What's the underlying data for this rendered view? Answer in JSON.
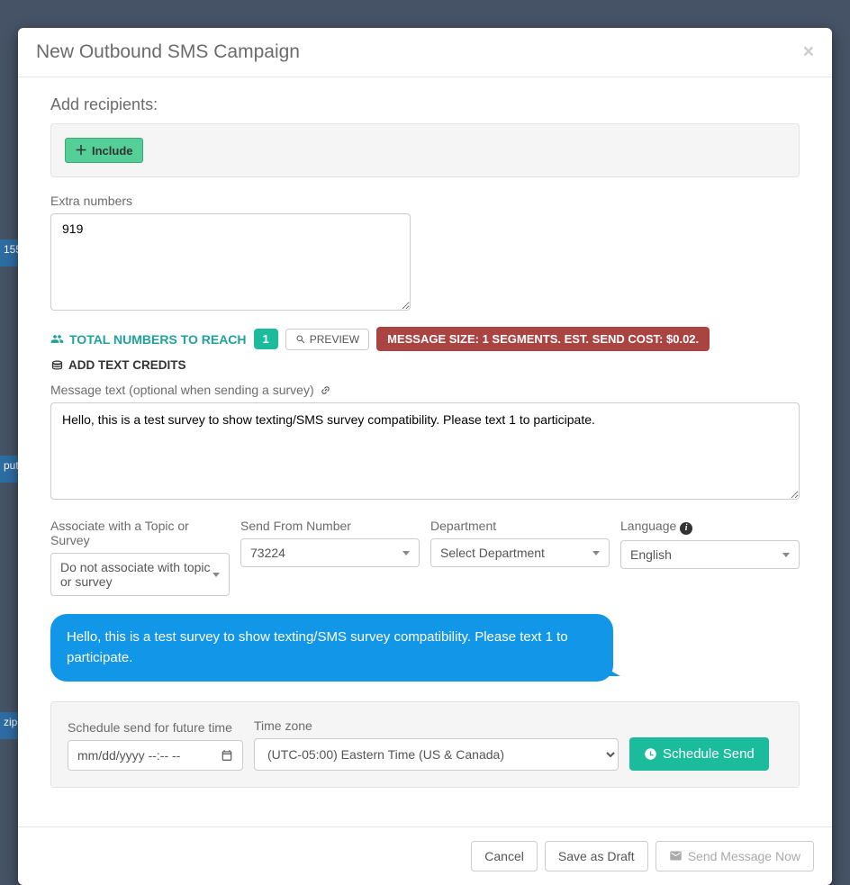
{
  "bg": {
    "s1": "155",
    "s2": "put",
    "s3": "zip"
  },
  "header": {
    "title": "New Outbound SMS Campaign"
  },
  "recipients": {
    "label": "Add recipients:",
    "include_label": "Include"
  },
  "extra": {
    "label": "Extra numbers",
    "value": "919"
  },
  "stats": {
    "total_label": "TOTAL NUMBERS TO REACH",
    "count": "1",
    "preview_label": "PREVIEW",
    "cost_label": "MESSAGE SIZE: 1 SEGMENTS. EST. SEND COST: $0.02.",
    "add_credits_label": "ADD TEXT CREDITS"
  },
  "message": {
    "label": "Message text (optional when sending a survey)",
    "value": "Hello, this is a test survey to show texting/SMS survey compatibility. Please text 1 to participate."
  },
  "selects": {
    "associate": {
      "label": "Associate with a Topic or Survey",
      "value": "Do not associate with topic or survey"
    },
    "from": {
      "label": "Send From Number",
      "value": "73224"
    },
    "department": {
      "label": "Department",
      "value": "Select Department"
    },
    "language": {
      "label": "Language",
      "value": "English"
    }
  },
  "preview_bubble": "Hello, this is a test survey to show texting/SMS survey compatibility. Please text 1 to participate.",
  "schedule": {
    "date_label": "Schedule send for future time",
    "date_placeholder": "mm/dd/yyyy --:-- --",
    "tz_label": "Time zone",
    "tz_value": "(UTC-05:00) Eastern Time (US & Canada)",
    "btn": "Schedule Send"
  },
  "footer": {
    "cancel": "Cancel",
    "draft": "Save as Draft",
    "send": "Send Message Now"
  }
}
